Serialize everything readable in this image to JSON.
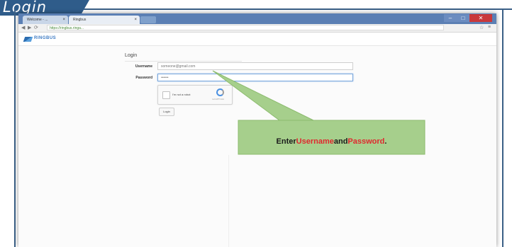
{
  "slide": {
    "section_title": "Login"
  },
  "browser": {
    "tab1_label": "Welcome - ...",
    "tab2_label": "Ringbus",
    "tab_close": "×",
    "url": "https://ringbus.ringa...",
    "win_min": "–",
    "win_max": "□",
    "win_close": "✕",
    "nav_back": "◀",
    "nav_forward": "▶",
    "nav_reload": "⟳",
    "nav_lock": "🔒",
    "tool_star": "☆",
    "tool_menu": "≡"
  },
  "site": {
    "logo_text": "RINGBUS"
  },
  "login": {
    "heading": "Login",
    "username_label": "Username",
    "username_value": "someone@gmail.com",
    "password_label": "Password",
    "password_value": "••••••",
    "captcha_label": "I'm not a robot",
    "captcha_small": "reCAPTCHA",
    "button_label": "Login"
  },
  "callout": {
    "prefix": "Enter ",
    "word1": "Username",
    "middle": " and ",
    "word2": "Password",
    "suffix": ".",
    "fill_color": "#a6cf8c",
    "highlight_color": "#e0282e"
  }
}
